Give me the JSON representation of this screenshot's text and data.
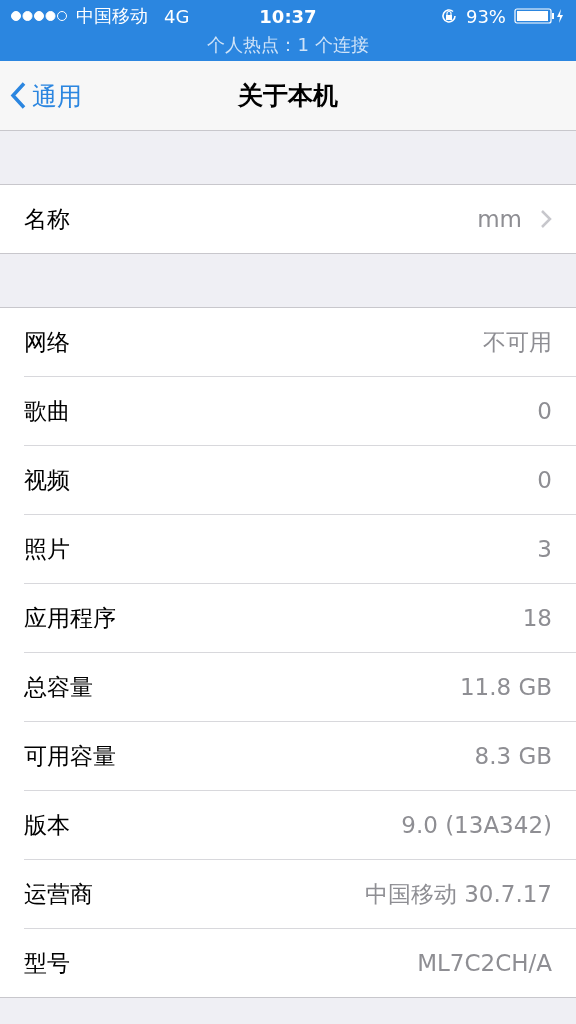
{
  "status_bar": {
    "carrier": "中国移动",
    "network": "4G",
    "time": "10:37",
    "battery": "93%",
    "hotspot": "个人热点：1 个连接"
  },
  "nav": {
    "back": "通用",
    "title": "关于本机"
  },
  "groups": [
    {
      "rows": [
        {
          "label": "名称",
          "value": "mm",
          "kind": "link"
        }
      ]
    },
    {
      "rows": [
        {
          "label": "网络",
          "value": "不可用",
          "kind": "info"
        },
        {
          "label": "歌曲",
          "value": "0",
          "kind": "info"
        },
        {
          "label": "视频",
          "value": "0",
          "kind": "info"
        },
        {
          "label": "照片",
          "value": "3",
          "kind": "info"
        },
        {
          "label": "应用程序",
          "value": "18",
          "kind": "info"
        },
        {
          "label": "总容量",
          "value": "11.8 GB",
          "kind": "info"
        },
        {
          "label": "可用容量",
          "value": "8.3 GB",
          "kind": "info"
        },
        {
          "label": "版本",
          "value": "9.0 (13A342)",
          "kind": "info"
        },
        {
          "label": "运营商",
          "value": "中国移动 30.7.17",
          "kind": "info"
        },
        {
          "label": "型号",
          "value": "ML7C2CH/A",
          "kind": "info"
        }
      ]
    }
  ]
}
